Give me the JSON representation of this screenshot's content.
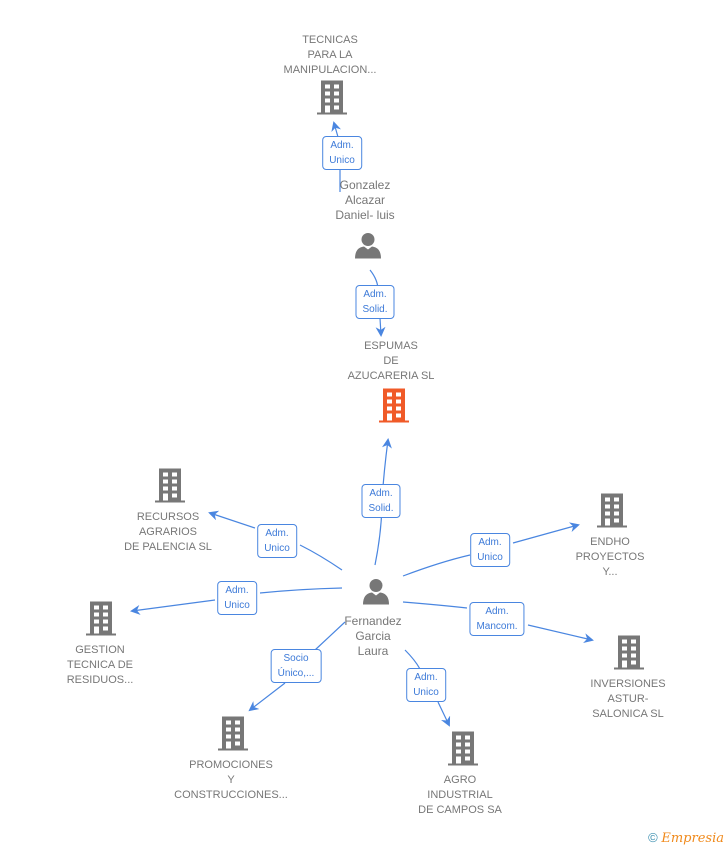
{
  "colors": {
    "edge": "#4a86e0",
    "building": "#777777",
    "building_focus": "#f05a28",
    "person": "#777777"
  },
  "nodes": {
    "tecnicas": {
      "lines": [
        "TECNICAS",
        "PARA LA",
        "MANIPULACION..."
      ]
    },
    "gonzalez": {
      "lines": [
        "Gonzalez",
        "Alcazar",
        "Daniel- luis"
      ]
    },
    "espumas": {
      "lines": [
        "ESPUMAS",
        "DE",
        "AZUCARERIA SL"
      ]
    },
    "fernandez": {
      "lines": [
        "Fernandez",
        "Garcia",
        "Laura"
      ]
    },
    "recursos": {
      "lines": [
        "RECURSOS",
        "AGRARIOS",
        "DE PALENCIA SL"
      ]
    },
    "gestion": {
      "lines": [
        "GESTION",
        "TECNICA DE",
        "RESIDUOS..."
      ]
    },
    "promociones": {
      "lines": [
        "PROMOCIONES",
        "Y",
        "CONSTRUCCIONES..."
      ]
    },
    "agro": {
      "lines": [
        "AGRO",
        "INDUSTRIAL",
        "DE CAMPOS SA"
      ]
    },
    "endho": {
      "lines": [
        "ENDHO",
        "PROYECTOS",
        "Y..."
      ]
    },
    "inversiones": {
      "lines": [
        "INVERSIONES",
        "ASTUR-",
        "SALONICA SL"
      ]
    }
  },
  "edges": {
    "gonzalez_tecnicas": [
      "Adm.",
      "Unico"
    ],
    "gonzalez_espumas": [
      "Adm.",
      "Solid."
    ],
    "fernandez_espumas": [
      "Adm.",
      "Solid."
    ],
    "fernandez_recursos": [
      "Adm.",
      "Unico"
    ],
    "fernandez_gestion": [
      "Adm.",
      "Unico"
    ],
    "fernandez_promociones": [
      "Socio",
      "Único,..."
    ],
    "fernandez_agro": [
      "Adm.",
      "Unico"
    ],
    "fernandez_endho": [
      "Adm.",
      "Unico"
    ],
    "fernandez_inversiones": [
      "Adm.",
      "Mancom."
    ]
  },
  "footer": {
    "copyright": "©",
    "brand": "Empresia"
  }
}
